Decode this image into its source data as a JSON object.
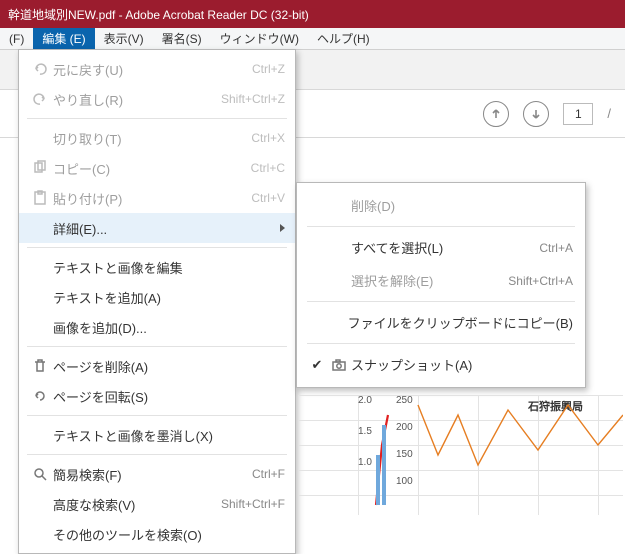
{
  "window": {
    "title": "幹道地域別NEW.pdf - Adobe Acrobat Reader DC (32-bit)"
  },
  "menubar": {
    "items": [
      {
        "label": "(F)"
      },
      {
        "label": "編集 (E)",
        "active": true
      },
      {
        "label": "表示(V)"
      },
      {
        "label": "署名(S)"
      },
      {
        "label": "ウィンドウ(W)"
      },
      {
        "label": "ヘルプ(H)"
      }
    ]
  },
  "toolbar2": {
    "page_current": "1",
    "page_sep": "/"
  },
  "edit_menu": {
    "undo": {
      "label": "元に戻す(U)",
      "shortcut": "Ctrl+Z"
    },
    "redo": {
      "label": "やり直し(R)",
      "shortcut": "Shift+Ctrl+Z"
    },
    "cut": {
      "label": "切り取り(T)",
      "shortcut": "Ctrl+X"
    },
    "copy": {
      "label": "コピー(C)",
      "shortcut": "Ctrl+C"
    },
    "paste": {
      "label": "貼り付け(P)",
      "shortcut": "Ctrl+V"
    },
    "more": {
      "label": "詳細(E)..."
    },
    "edit_ti": {
      "label": "テキストと画像を編集"
    },
    "add_text": {
      "label": "テキストを追加(A)"
    },
    "add_image": {
      "label": "画像を追加(D)..."
    },
    "del_page": {
      "label": "ページを削除(A)"
    },
    "rot_page": {
      "label": "ページを回転(S)"
    },
    "redact": {
      "label": "テキストと画像を墨消し(X)"
    },
    "find": {
      "label": "簡易検索(F)",
      "shortcut": "Ctrl+F"
    },
    "adv_find": {
      "label": "高度な検索(V)",
      "shortcut": "Shift+Ctrl+F"
    },
    "other_tools": {
      "label": "その他のツールを検索(O)"
    }
  },
  "submenu": {
    "delete": {
      "label": "削除(D)"
    },
    "select_all": {
      "label": "すべてを選択(L)",
      "shortcut": "Ctrl+A"
    },
    "deselect": {
      "label": "選択を解除(E)",
      "shortcut": "Shift+Ctrl+A"
    },
    "clip": {
      "label": "ファイルをクリップボードにコピー(B)"
    },
    "snapshot": {
      "label": "スナップショット(A)",
      "checked": true
    }
  },
  "chart_data": {
    "type": "line",
    "title": "石狩振興局",
    "left_axis_ticks": [
      1.0,
      1.5,
      2.0
    ],
    "right_axis_ticks": [
      100,
      150,
      200,
      250
    ],
    "series": [
      {
        "name": "blue-bars",
        "color": "#6fa8dc"
      },
      {
        "name": "red-line",
        "color": "#e02020"
      },
      {
        "name": "orange-line",
        "color": "#e67e22"
      }
    ]
  }
}
